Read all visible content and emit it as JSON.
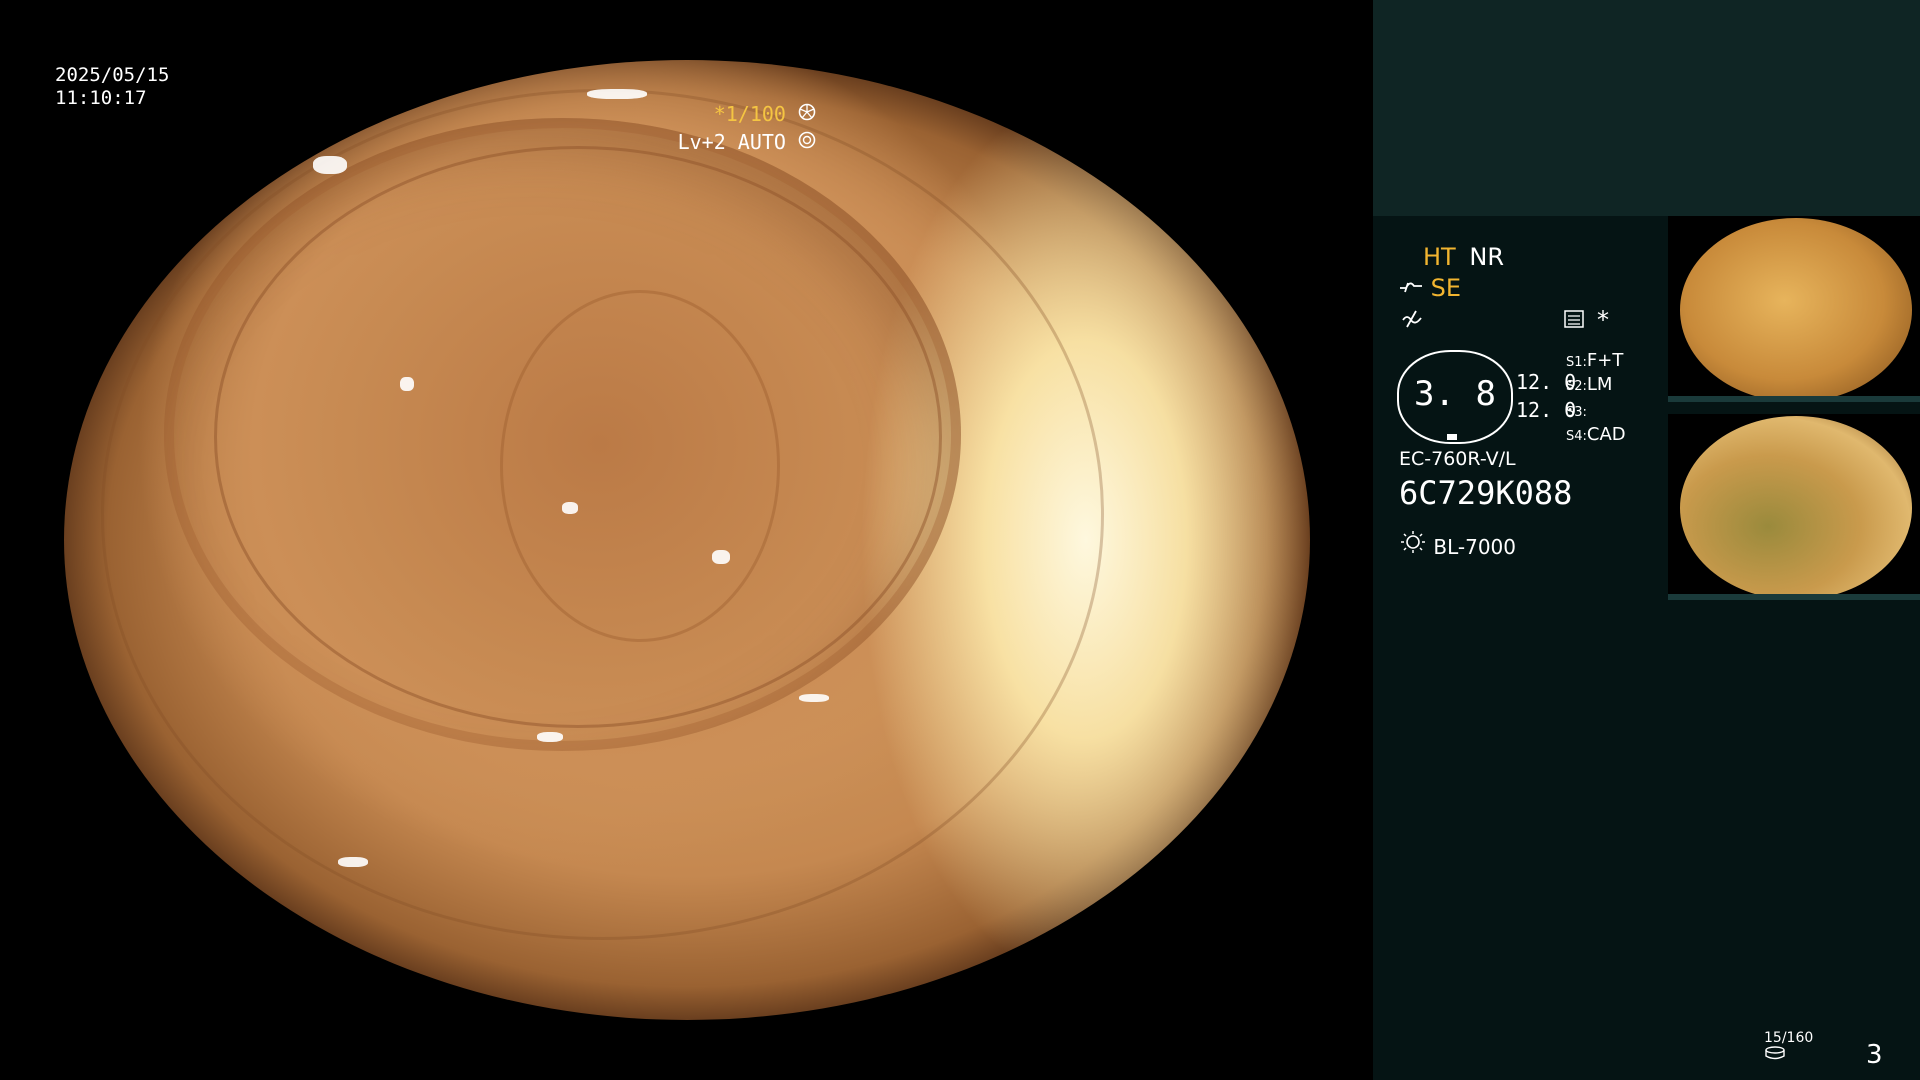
{
  "overlay": {
    "date": "2025/05/15",
    "time": "11:10:17",
    "shutter": "*1/100",
    "level": "Lv+2 AUTO"
  },
  "panel": {
    "mode_ht": "HT",
    "mode_nr": "NR",
    "mode_se": "SE",
    "star": "*",
    "zoom_value": "3. 8",
    "val1": "12. 0",
    "val2": "12. 0",
    "s1_label": "S1:",
    "s1_value": "F+T",
    "s2_label": "S2:",
    "s2_value": "LM",
    "s3_label": "S3:",
    "s3_value": "",
    "s4_label": "S4:",
    "s4_value": "CAD",
    "scope_model": "EC-760R-V/L",
    "serial": "6C729K088",
    "light_source": "BL-7000",
    "counter": "15/160",
    "page_number": "3"
  },
  "icons": {
    "shutter": "aperture-icon",
    "auto": "iris-icon",
    "se": "curve-icon",
    "enhance": "wave-icon",
    "grid": "stack-icon",
    "lamp": "lamp-icon",
    "storage": "disk-icon"
  }
}
